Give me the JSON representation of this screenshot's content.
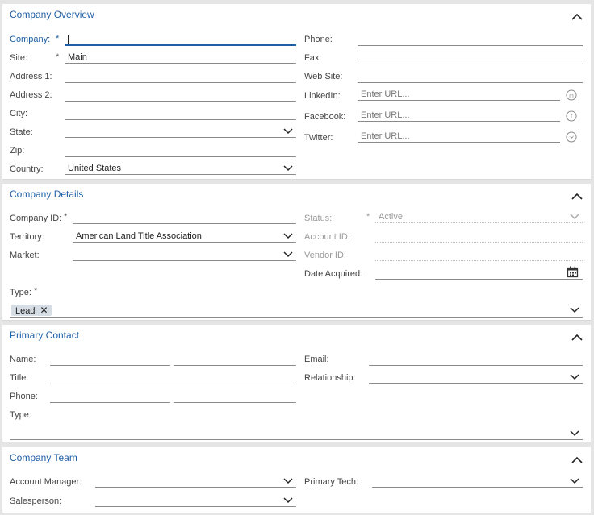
{
  "overview": {
    "title": "Company Overview",
    "company_label": "Company:",
    "company_value": "",
    "site_label": "Site:",
    "site_value": "Main",
    "address1_label": "Address 1:",
    "address2_label": "Address 2:",
    "city_label": "City:",
    "state_label": "State:",
    "zip_label": "Zip:",
    "country_label": "Country:",
    "country_value": "United States",
    "phone_label": "Phone:",
    "fax_label": "Fax:",
    "website_label": "Web Site:",
    "linkedin_label": "LinkedIn:",
    "facebook_label": "Facebook:",
    "twitter_label": "Twitter:",
    "url_placeholder": "Enter URL...",
    "required_mark": "*"
  },
  "details": {
    "title": "Company Details",
    "company_id_label": "Company ID:",
    "territory_label": "Territory:",
    "territory_value": "American Land Title Association",
    "market_label": "Market:",
    "type_label": "Type:",
    "type_chip": "Lead",
    "status_label": "Status:",
    "status_value": "Active",
    "account_id_label": "Account ID:",
    "vendor_id_label": "Vendor ID:",
    "date_acquired_label": "Date Acquired:"
  },
  "contact": {
    "title": "Primary Contact",
    "name_label": "Name:",
    "title_label": "Title:",
    "phone_label": "Phone:",
    "type_label": "Type:",
    "email_label": "Email:",
    "relationship_label": "Relationship:"
  },
  "team": {
    "title": "Company Team",
    "account_manager_label": "Account Manager:",
    "salesperson_label": "Salesperson:",
    "primary_tech_label": "Primary Tech:"
  },
  "icons": {
    "collapse": "chevron-up-icon",
    "dropdown": "chevron-down-icon",
    "linkedin": "linkedin-icon",
    "facebook": "facebook-icon",
    "twitter": "twitter-icon",
    "calendar": "calendar-icon",
    "remove": "close-icon"
  },
  "colors": {
    "accent": "#1f5fa6",
    "chip": "#d7dde4"
  }
}
